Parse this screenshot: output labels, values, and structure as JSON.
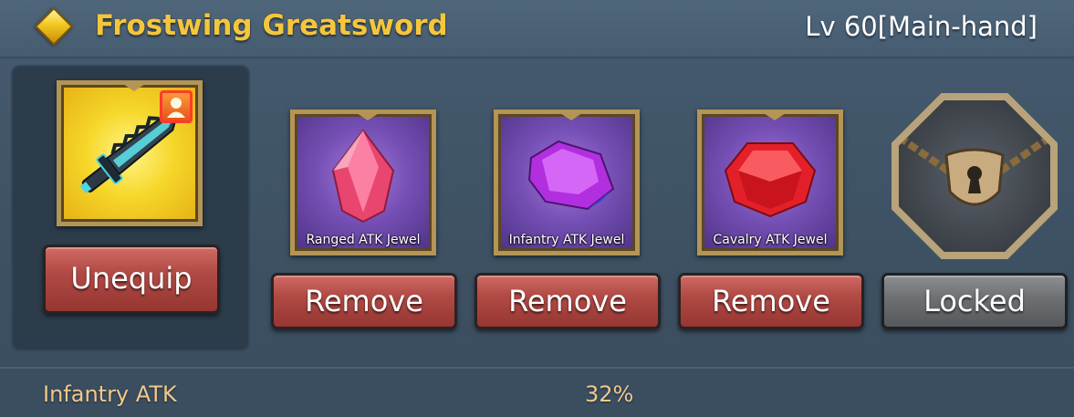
{
  "header": {
    "title": "Frostwing Greatsword",
    "level": "Lv 60[Main-hand]",
    "title_color": "#f4c63c"
  },
  "weapon": {
    "icon": "greatsword-icon",
    "badge_icon": "hero-silhouette-icon",
    "unequip_label": "Unequip"
  },
  "jewels": [
    {
      "label": "Ranged ATK Jewel",
      "color": "#f04a78",
      "button": "Remove",
      "icon": "pink-jewel-icon"
    },
    {
      "label": "Infantry ATK Jewel",
      "color": "#b43ae8",
      "button": "Remove",
      "icon": "purple-jewel-icon"
    },
    {
      "label": "Cavalry ATK Jewel",
      "color": "#e5272b",
      "button": "Remove",
      "icon": "red-jewel-icon"
    }
  ],
  "locked_slot": {
    "icon": "padlock-shield-icon",
    "button": "Locked"
  },
  "stats": [
    {
      "name": "Infantry ATK",
      "value": "32%"
    }
  ],
  "colors": {
    "remove_button": "#b14a45",
    "locked_button": "#6d6f73",
    "stat_text": "#f0c98c"
  }
}
